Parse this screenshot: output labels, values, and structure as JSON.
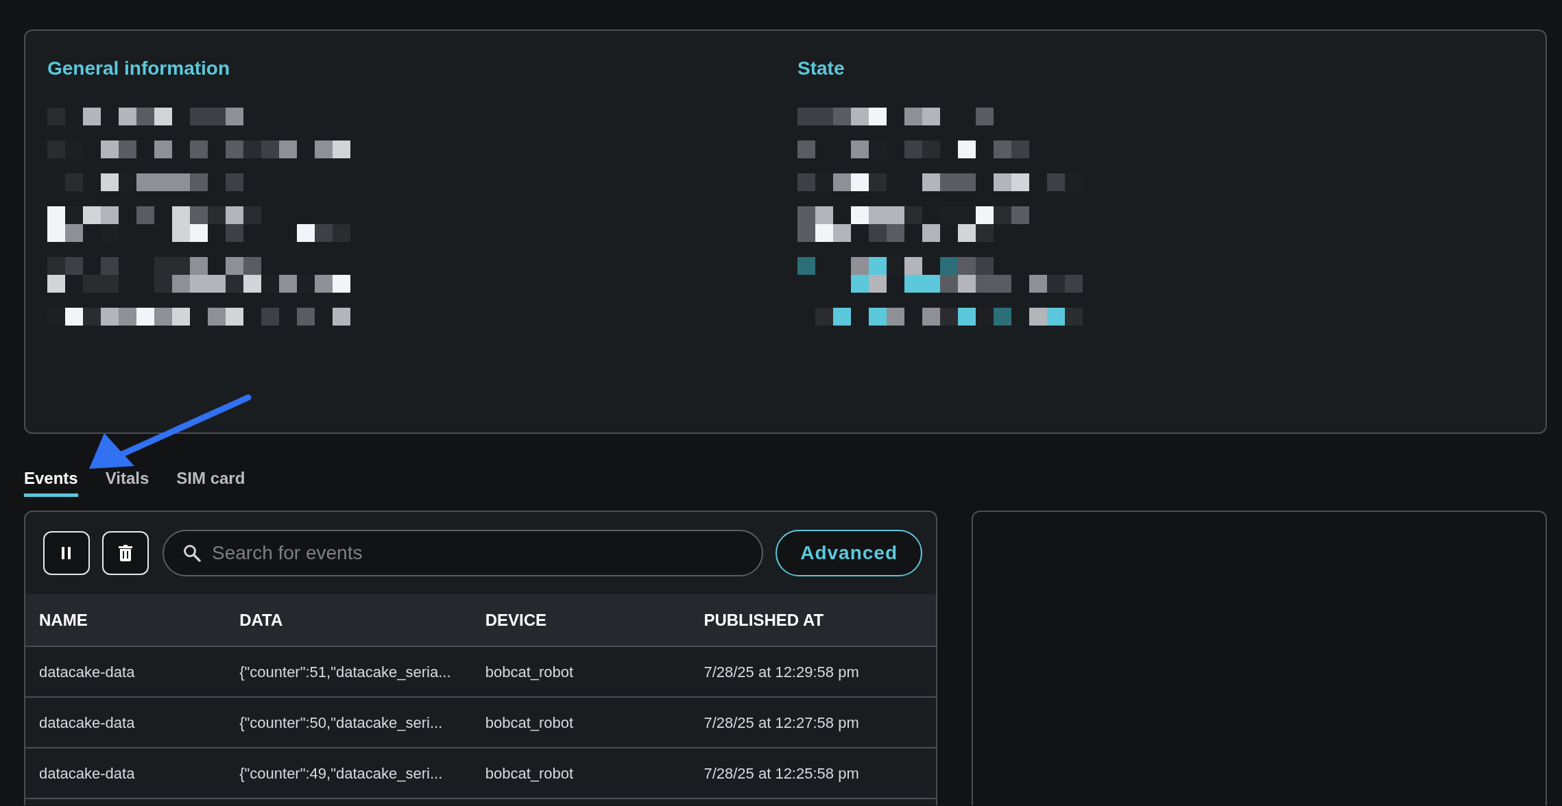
{
  "info_panel": {
    "sections": [
      {
        "title": "General information"
      },
      {
        "title": "State"
      }
    ]
  },
  "tabs": [
    {
      "label": "Events",
      "selected": true
    },
    {
      "label": "Vitals",
      "selected": false
    },
    {
      "label": "SIM card",
      "selected": false
    }
  ],
  "events": {
    "search": {
      "placeholder": "Search for events"
    },
    "advanced_button": "Advanced",
    "table": {
      "columns": [
        "NAME",
        "DATA",
        "DEVICE",
        "PUBLISHED AT"
      ],
      "rows": [
        [
          "datacake-data",
          "{\"counter\":51,\"datacake_seria...",
          "bobcat_robot",
          "7/28/25 at 12:29:58 pm"
        ],
        [
          "datacake-data",
          "{\"counter\":50,\"datacake_seri...",
          "bobcat_robot",
          "7/28/25 at 12:27:58 pm"
        ],
        [
          "datacake-data",
          "{\"counter\":49,\"datacake_seri...",
          "bobcat_robot",
          "7/28/25 at 12:25:58 pm"
        ]
      ]
    }
  }
}
